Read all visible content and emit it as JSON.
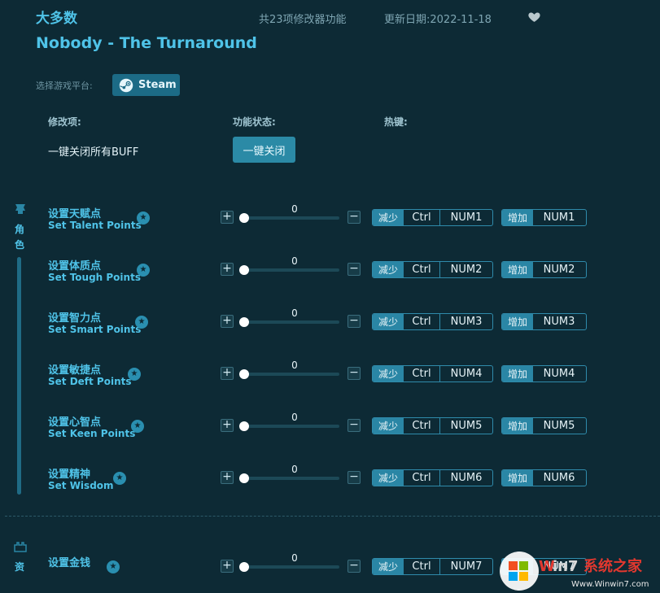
{
  "header": {
    "title_cn": "大多数",
    "feature_count": "共23项修改器功能",
    "update_date": "更新日期:2022-11-18",
    "title_en": "Nobody - The Turnaround"
  },
  "platform": {
    "label": "选择游戏平台:",
    "steam_label": "Steam"
  },
  "columns": {
    "mod": "修改项:",
    "status": "功能状态:",
    "hotkey": "热键:"
  },
  "buff": {
    "label": "一键关闭所有BUFF",
    "button": "一键关闭"
  },
  "category1": {
    "label_line1": "角",
    "label_line2": "色"
  },
  "category2": {
    "label": "资"
  },
  "rows": [
    {
      "cn": "设置天赋点",
      "en": "Set Talent Points",
      "value": "0",
      "dec_tag": "减少",
      "dec_mod": "Ctrl",
      "dec_key": "NUM1",
      "inc_tag": "增加",
      "inc_key": "NUM1"
    },
    {
      "cn": "设置体质点",
      "en": "Set Tough Points",
      "value": "0",
      "dec_tag": "减少",
      "dec_mod": "Ctrl",
      "dec_key": "NUM2",
      "inc_tag": "增加",
      "inc_key": "NUM2"
    },
    {
      "cn": "设置智力点",
      "en": "Set Smart Points",
      "value": "0",
      "dec_tag": "减少",
      "dec_mod": "Ctrl",
      "dec_key": "NUM3",
      "inc_tag": "增加",
      "inc_key": "NUM3"
    },
    {
      "cn": "设置敏捷点",
      "en": "Set Deft Points",
      "value": "0",
      "dec_tag": "减少",
      "dec_mod": "Ctrl",
      "dec_key": "NUM4",
      "inc_tag": "增加",
      "inc_key": "NUM4"
    },
    {
      "cn": "设置心智点",
      "en": "Set Keen Points",
      "value": "0",
      "dec_tag": "减少",
      "dec_mod": "Ctrl",
      "dec_key": "NUM5",
      "inc_tag": "增加",
      "inc_key": "NUM5"
    },
    {
      "cn": "设置精神",
      "en": "Set Wisdom",
      "value": "0",
      "dec_tag": "减少",
      "dec_mod": "Ctrl",
      "dec_key": "NUM6",
      "inc_tag": "增加",
      "inc_key": "NUM6"
    },
    {
      "cn": "设置金钱",
      "en": "",
      "value": "0",
      "dec_tag": "减少",
      "dec_mod": "Ctrl",
      "dec_key": "NUM7",
      "inc_tag": "增加",
      "inc_key": "NUM7"
    }
  ],
  "icons": {
    "heart": "heart-icon",
    "steam": "steam-icon",
    "star": "star-icon",
    "category1": "character-icon",
    "category2": "resource-icon"
  },
  "watermark": {
    "text_cn": "系统之家",
    "text_url": "Www.Winwin7.com"
  },
  "colors": {
    "background": "#0d2a35",
    "accent": "#4fc3e8",
    "button": "#2b8aa6"
  }
}
